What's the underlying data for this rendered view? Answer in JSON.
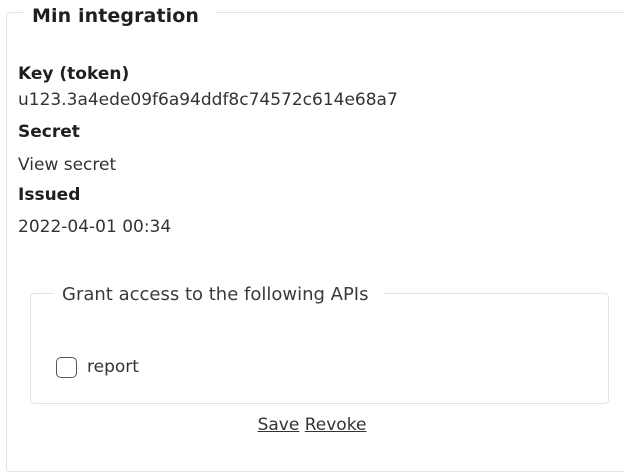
{
  "integration": {
    "title": "Min integration",
    "key_label": "Key (token)",
    "key_value": "u123.3a4ede09f6a94ddf8c74572c614e68a7",
    "secret_label": "Secret",
    "secret_value": "View secret",
    "issued_label": "Issued",
    "issued_value": "2022-04-01 00:34"
  },
  "grant": {
    "legend": "Grant access to the following APIs",
    "apis": [
      {
        "label": "report",
        "checked": false
      }
    ]
  },
  "actions": {
    "save_label": "Save",
    "revoke_label": "Revoke"
  }
}
